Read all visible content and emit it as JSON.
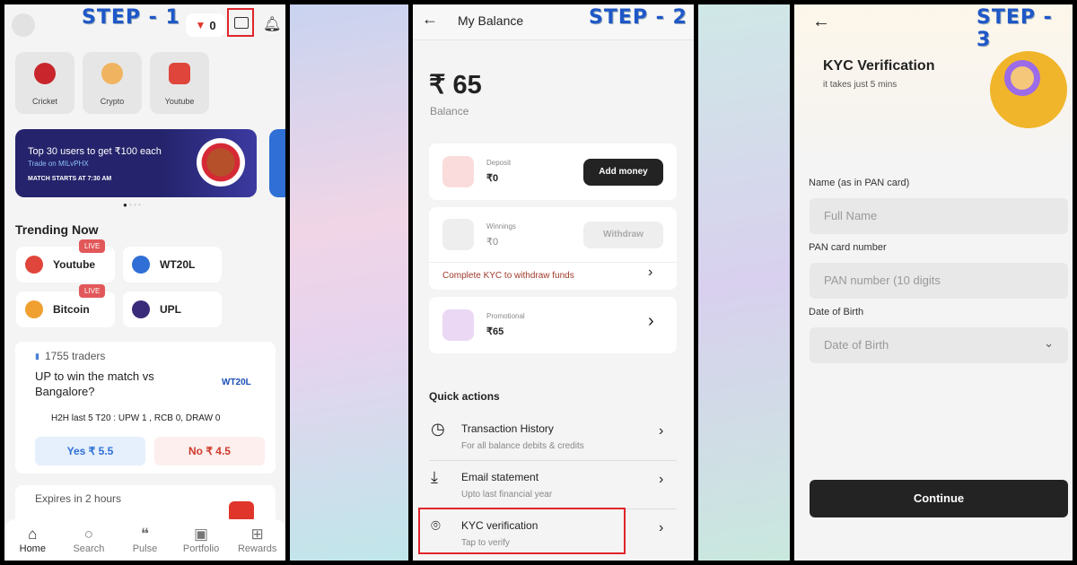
{
  "step1": {
    "step_label": "STEP - 1",
    "coins": "0",
    "categories": [
      {
        "label": "Cricket"
      },
      {
        "label": "Crypto"
      },
      {
        "label": "Youtube"
      }
    ],
    "banner": {
      "title": "Top 30 users to get ₹100 each",
      "subtitle": "Trade on MILvPHX",
      "cta": "MATCH STARTS AT 7:30 AM"
    },
    "trending_title": "Trending Now",
    "live_badge": "LIVE",
    "trending": [
      {
        "label": "Youtube"
      },
      {
        "label": "WT20L"
      },
      {
        "label": "Bitcoin"
      },
      {
        "label": "UPL"
      }
    ],
    "market": {
      "traders": "1755 traders",
      "question": "UP to win the match vs Bangalore?",
      "logo": "WT20L",
      "h2h": "H2H last 5 T20 : UPW 1 ,  RCB 0, DRAW 0",
      "yes": "Yes ₹ 5.5",
      "no": "No ₹ 4.5"
    },
    "market2": {
      "expires": "Expires in 2 hours"
    },
    "nav": [
      {
        "label": "Home"
      },
      {
        "label": "Search"
      },
      {
        "label": "Pulse"
      },
      {
        "label": "Portfolio"
      },
      {
        "label": "Rewards"
      }
    ]
  },
  "step2": {
    "step_label": "STEP - 2",
    "title": "My Balance",
    "balance": "₹ 65",
    "balance_label": "Balance",
    "deposit": {
      "label": "Deposit",
      "value": "₹0",
      "button": "Add money"
    },
    "winnings": {
      "label": "Winnings",
      "value": "₹0",
      "button": "Withdraw",
      "kyc_link": "Complete KYC to withdraw funds"
    },
    "promotional": {
      "label": "Promotional",
      "value": "₹65"
    },
    "quick_title": "Quick actions",
    "actions": [
      {
        "title": "Transaction History",
        "sub": "For all balance debits & credits"
      },
      {
        "title": "Email statement",
        "sub": "Upto last financial year"
      },
      {
        "title": "KYC verification",
        "sub": "Tap to verify"
      }
    ]
  },
  "step3": {
    "step_label": "STEP - 3",
    "title": "KYC Verification",
    "subtitle": "it takes just 5 mins",
    "name_label": "Name (as in PAN card)",
    "name_placeholder": "Full Name",
    "pan_label": "PAN card number",
    "pan_placeholder": "PAN number (10 digits",
    "dob_label": "Date of Birth",
    "dob_placeholder": "Date of Birth",
    "continue": "Continue"
  },
  "colors": {
    "step": "#1e57c7",
    "highlight": "#e0252b",
    "yes": "#2f6fd6",
    "no": "#d0392b",
    "dark_button": "#232323",
    "banner": "#24236b"
  }
}
